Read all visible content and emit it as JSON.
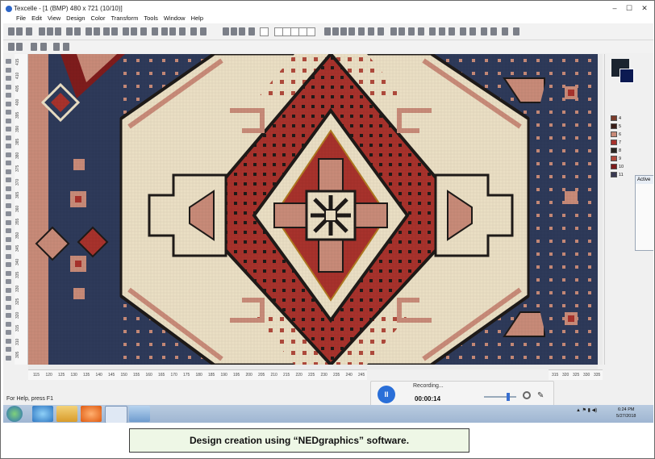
{
  "window": {
    "title": "Texcelle - [1 (BMP) 480 x 721 (10/10)]",
    "controls": [
      "–",
      "☐",
      "✕"
    ]
  },
  "menubar": {
    "items": [
      "File",
      "Edit",
      "View",
      "Design",
      "Color",
      "Transform",
      "Tools",
      "Window",
      "Help"
    ]
  },
  "rulers": {
    "vertical_ticks": [
      "415",
      "410",
      "405",
      "400",
      "395",
      "390",
      "385",
      "380",
      "375",
      "370",
      "365",
      "360",
      "355",
      "350",
      "345",
      "340",
      "335",
      "330",
      "325",
      "320",
      "315",
      "310",
      "305"
    ],
    "horizontal_ticks": [
      "115",
      "120",
      "125",
      "130",
      "135",
      "140",
      "145",
      "150",
      "155",
      "160",
      "165",
      "170",
      "175",
      "180",
      "185",
      "190",
      "195",
      "200",
      "205",
      "210",
      "215",
      "220",
      "225",
      "230",
      "235",
      "240",
      "245"
    ],
    "horizontal_ticks_right": [
      "315",
      "320",
      "325",
      "330",
      "335"
    ]
  },
  "palette": {
    "entries": [
      {
        "index": "4",
        "color": "#7a3b2a"
      },
      {
        "index": "5",
        "color": "#3a1e18"
      },
      {
        "index": "6",
        "color": "#c88a78"
      },
      {
        "index": "7",
        "color": "#a8322c"
      },
      {
        "index": "8",
        "color": "#2a2622"
      },
      {
        "index": "9",
        "color": "#b04a3c"
      },
      {
        "index": "10",
        "color": "#7f1c1c"
      },
      {
        "index": "11",
        "color": "#3a3a52"
      }
    ],
    "fg_color": "#1b2430",
    "bg_color": "#0c1a52"
  },
  "active_panel": {
    "title": "Active"
  },
  "status": {
    "help_text": "For Help, press F1"
  },
  "recorder": {
    "label": "Recording...",
    "time": "00:00:14",
    "pause_glyph": "II"
  },
  "taskbar": {
    "time": "6:24 PM",
    "date": "5/27/2018"
  },
  "caption": "Design creation using “NEDgraphics” software.",
  "colors": {
    "navy": "#2e3a5a",
    "cream": "#eadfc4",
    "red": "#a8322c",
    "dark_red": "#7f1c1c",
    "pink": "#c88a78",
    "dark": "#1e1a18",
    "caption_bg": "#eef7e6"
  }
}
